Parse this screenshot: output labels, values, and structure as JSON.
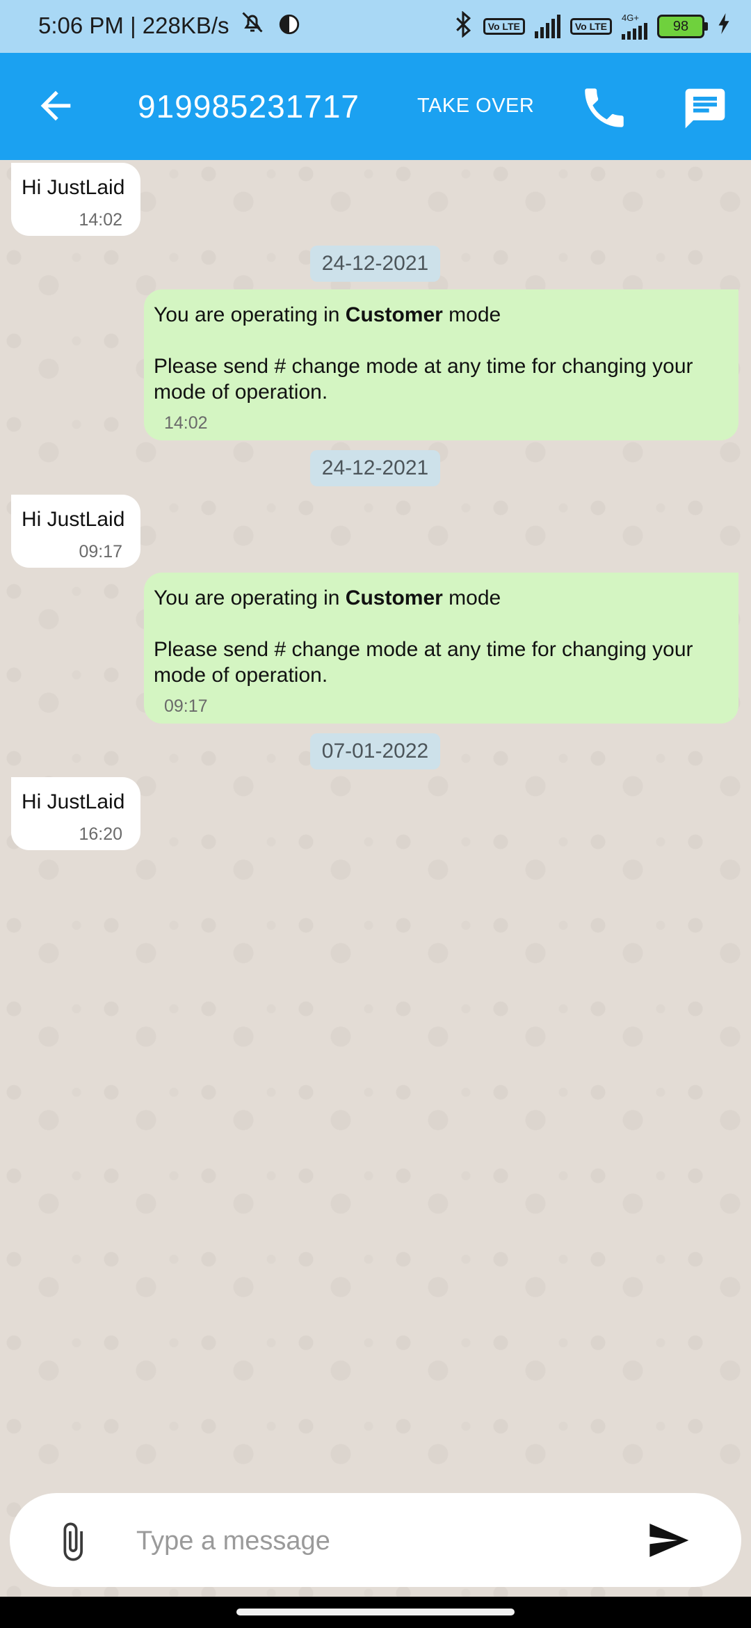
{
  "status_bar": {
    "time_text": "5:06 PM | 228KB/s",
    "sim1_tag": "Vo LTE",
    "sim2_tag": "Vo LTE",
    "network_tag": "4G+",
    "battery_level": "98"
  },
  "app_bar": {
    "contact_number": "919985231717",
    "take_over_label": "TAKE OVER"
  },
  "messages": {
    "m1": {
      "text": "Hi JustLaid",
      "time": "14:02"
    },
    "d1": "24-12-2021",
    "m2": {
      "line1_pre": "You are operating in ",
      "line1_bold": "Customer",
      "line1_post": " mode",
      "line2": "Please send # change mode at any time for changing your",
      "line3": "mode of operation.",
      "time": "14:02"
    },
    "d2": "24-12-2021",
    "m3": {
      "text": "Hi JustLaid",
      "time": "09:17"
    },
    "m4": {
      "line1_pre": "You are operating in ",
      "line1_bold": "Customer",
      "line1_post": " mode",
      "line2": "Please send # change mode at any time for changing your",
      "line3": "mode of operation.",
      "time": "09:17"
    },
    "d3": "07-01-2022",
    "m5": {
      "text": "Hi JustLaid",
      "time": "16:20"
    }
  },
  "composer": {
    "placeholder": "Type a message"
  },
  "icons": {
    "back": "arrow-left-icon",
    "call": "phone-icon",
    "message": "message-icon",
    "attach": "paperclip-icon",
    "send": "send-icon",
    "mute": "bell-off-icon",
    "bluetooth": "bluetooth-icon"
  },
  "colors": {
    "app_bar": "#1ba1f1",
    "status_bar": "#a9d8f5",
    "outgoing_bubble": "#d4f5c2",
    "incoming_bubble": "#ffffff",
    "date_chip": "#cde1ea"
  }
}
